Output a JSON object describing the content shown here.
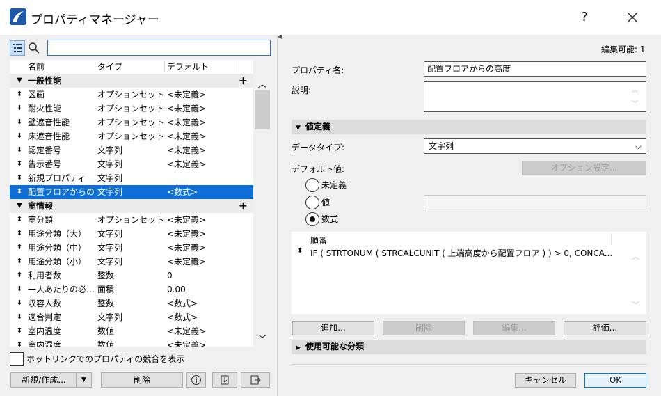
{
  "window": {
    "title": "プロパティマネージャー",
    "help_label": "?"
  },
  "search": {
    "value": "",
    "placeholder": ""
  },
  "list": {
    "columns": [
      "名前",
      "タイプ",
      "デフォルト"
    ],
    "rows": [
      {
        "kind": "group",
        "name": "一般性能"
      },
      {
        "kind": "item",
        "name": "区画",
        "type": "オプションセット",
        "default": "<未定義>"
      },
      {
        "kind": "item",
        "name": "耐火性能",
        "type": "オプションセット",
        "default": "<未定義>"
      },
      {
        "kind": "item",
        "name": "壁遮音性能",
        "type": "オプションセット",
        "default": "<未定義>"
      },
      {
        "kind": "item",
        "name": "床遮音性能",
        "type": "オプションセット",
        "default": "<未定義>"
      },
      {
        "kind": "item",
        "name": "認定番号",
        "type": "文字列",
        "default": "<未定義>"
      },
      {
        "kind": "item",
        "name": "告示番号",
        "type": "文字列",
        "default": "<未定義>"
      },
      {
        "kind": "item",
        "name": "新規プロパティ",
        "type": "文字列",
        "default": ""
      },
      {
        "kind": "item",
        "name": "配置フロアからの…",
        "type": "文字列",
        "default": "<数式>",
        "selected": true
      },
      {
        "kind": "group",
        "name": "室情報"
      },
      {
        "kind": "item",
        "name": "室分類",
        "type": "オプションセット",
        "default": "<未定義>"
      },
      {
        "kind": "item",
        "name": "用途分類（大）",
        "type": "文字列",
        "default": "<未定義>"
      },
      {
        "kind": "item",
        "name": "用途分類（中）",
        "type": "文字列",
        "default": "<未定義>"
      },
      {
        "kind": "item",
        "name": "用途分類（小）",
        "type": "文字列",
        "default": "<未定義>"
      },
      {
        "kind": "item",
        "name": "利用者数",
        "type": "整数",
        "default": "0"
      },
      {
        "kind": "item",
        "name": "一人あたりの必…",
        "type": "面積",
        "default": "0.00"
      },
      {
        "kind": "item",
        "name": "収容人数",
        "type": "整数",
        "default": "<数式>"
      },
      {
        "kind": "item",
        "name": "適合判定",
        "type": "文字列",
        "default": "<数式>"
      },
      {
        "kind": "item",
        "name": "室内温度",
        "type": "数値",
        "default": "<未定義>"
      },
      {
        "kind": "item",
        "name": "室内湿度",
        "type": "数値",
        "default": "<未定義>"
      }
    ]
  },
  "hotlink_label": "ホットリンクでのプロパティの競合を表示",
  "left_buttons": {
    "new": "新規/作成...",
    "delete": "削除"
  },
  "right": {
    "editable": "編集可能: 1",
    "prop_name_label": "プロパティ名:",
    "prop_name_value": "配置フロアからの高度",
    "desc_label": "説明:",
    "value_def_section": "値定義",
    "datatype_label": "データタイプ:",
    "datatype_value": "文字列",
    "default_label": "デフォルト値:",
    "option_btn": "オプション設定...",
    "radio_undefined": "未定義",
    "radio_value": "値",
    "radio_formula": "数式",
    "formula_header": "順番",
    "formula_text": "IF ( STRTONUM ( STRCALCUNIT ( 上端高度から配置フロア ) ) > 0, CONCA...",
    "add_btn": "追加...",
    "delete_btn": "削除",
    "edit_btn": "編集...",
    "eval_btn": "評価...",
    "classification_section": "使用可能な分類",
    "cancel_btn": "キャンセル",
    "ok_btn": "OK"
  }
}
